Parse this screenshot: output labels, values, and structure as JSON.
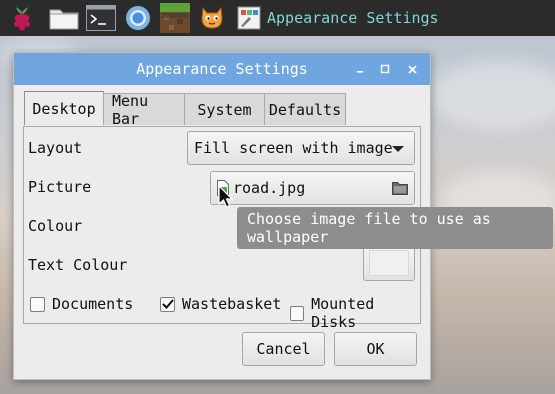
{
  "taskbar": {
    "launchers": [
      {
        "name": "raspberry-menu",
        "icon": "raspberry-icon"
      },
      {
        "name": "file-manager",
        "icon": "folder-icon"
      },
      {
        "name": "terminal",
        "icon": "terminal-icon"
      },
      {
        "name": "browser",
        "icon": "chromium-icon"
      },
      {
        "name": "minecraft",
        "icon": "minecraft-icon"
      },
      {
        "name": "scratch",
        "icon": "scratch-cat-icon"
      }
    ],
    "active_window_title": "Appearance Settings"
  },
  "dialog": {
    "title": "Appearance Settings",
    "tabs": [
      "Desktop",
      "Menu Bar",
      "System",
      "Defaults"
    ],
    "active_tab": "Desktop",
    "rows": {
      "layout_label": "Layout",
      "layout_value": "Fill screen with image",
      "picture_label": "Picture",
      "picture_value": "road.jpg",
      "colour_label": "Colour",
      "text_colour_label": "Text Colour"
    },
    "checkboxes": [
      {
        "label": "Documents",
        "checked": false
      },
      {
        "label": "Wastebasket",
        "checked": true
      },
      {
        "label": "Mounted Disks",
        "checked": false
      }
    ],
    "buttons": {
      "cancel": "Cancel",
      "ok": "OK"
    }
  },
  "tooltip": {
    "text": "Choose image file to use as wallpaper"
  },
  "colors": {
    "titlebar": "#6fa6df",
    "taskbar": "#2b2b2b",
    "taskbar_text": "#7fd6d6",
    "tooltip_bg": "#8d8d8d"
  }
}
